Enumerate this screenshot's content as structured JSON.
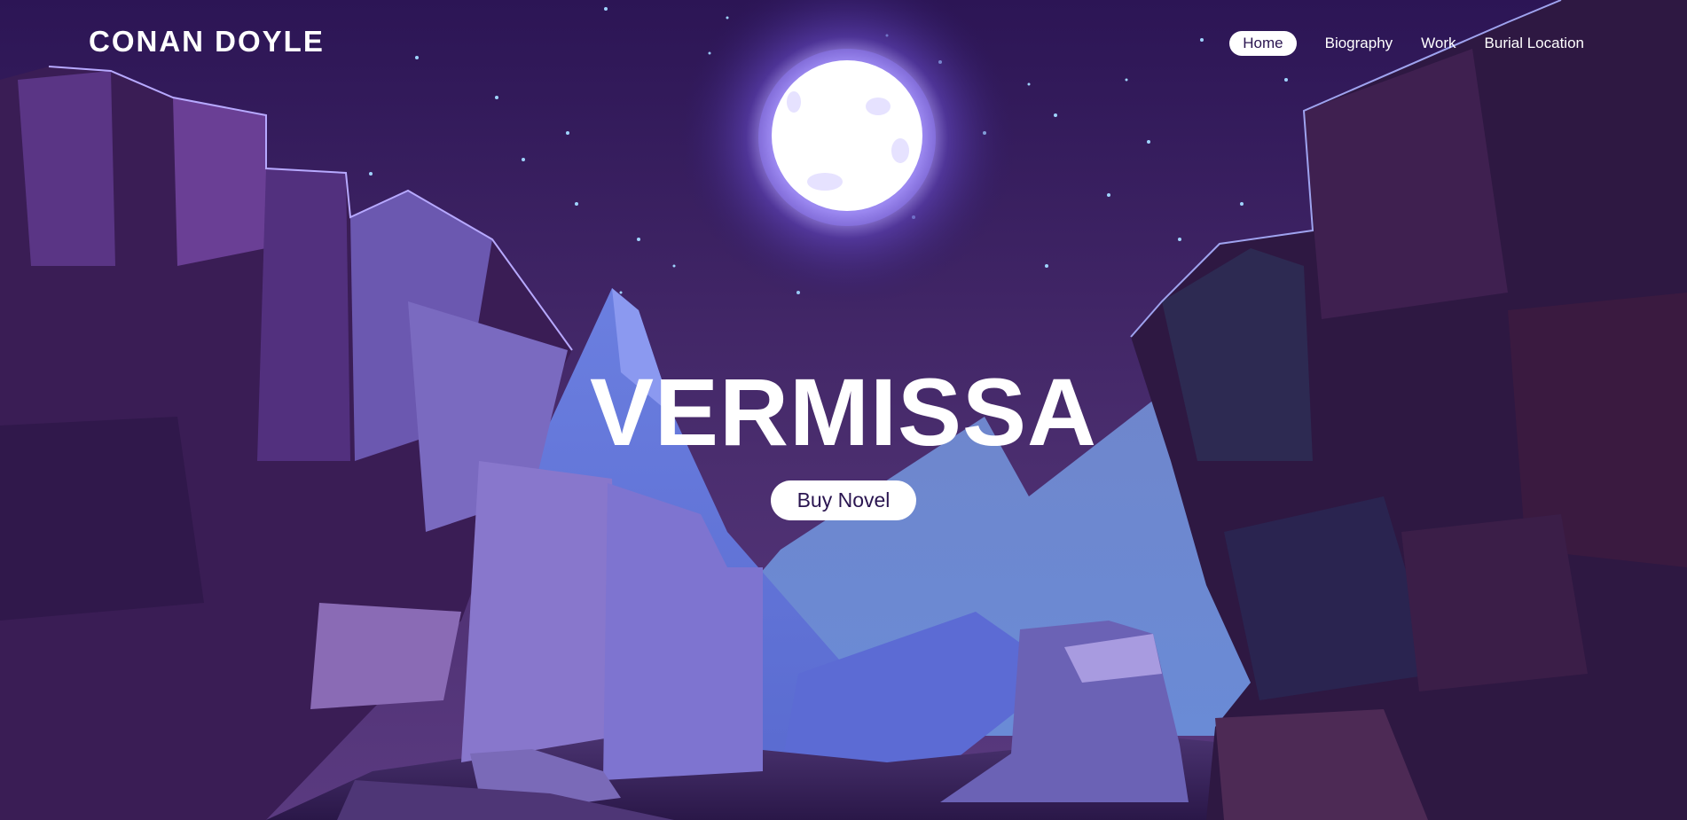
{
  "brand": {
    "name": "CONAN DOYLE"
  },
  "nav": {
    "items": [
      {
        "label": "Home",
        "active": true
      },
      {
        "label": "Biography",
        "active": false
      },
      {
        "label": "Work",
        "active": false
      },
      {
        "label": "Burial Location",
        "active": false
      }
    ]
  },
  "hero": {
    "title": "VERMISSA",
    "cta_label": "Buy Novel"
  },
  "colors": {
    "sky": "#2a1550",
    "moon": "#ffffff",
    "mountain": "#6d7fd6",
    "cliff": "#3a1f55"
  },
  "icons": [
    "moon-illustration"
  ]
}
